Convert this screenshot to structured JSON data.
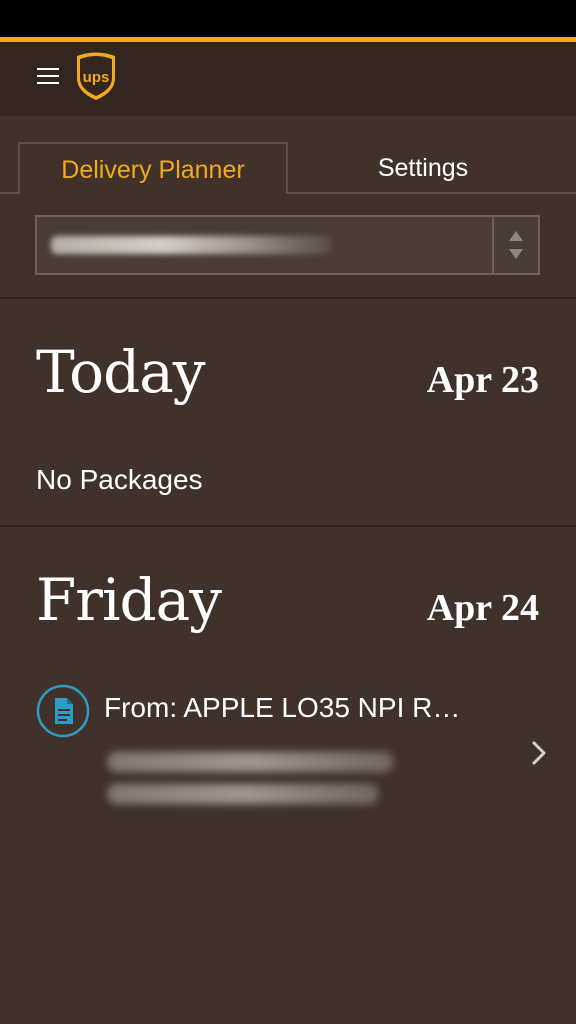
{
  "colors": {
    "background": "#40322b",
    "header": "#33261f",
    "accent": "#f2a91c",
    "icon_blue": "#2b9cc4",
    "text": "#ffffff"
  },
  "header": {
    "menu_icon": "hamburger-icon",
    "logo_text": "ups"
  },
  "tabs": [
    {
      "label": "Delivery Planner",
      "active": true
    },
    {
      "label": "Settings",
      "active": false
    }
  ],
  "picker": {
    "value": "",
    "icon": "up-down-arrows-icon"
  },
  "days": [
    {
      "title": "Today",
      "date": "Apr 23",
      "status": "No Packages"
    },
    {
      "title": "Friday",
      "date": "Apr 24",
      "packages": [
        {
          "from": "From: APPLE LO35 NPI R…",
          "icon": "document-icon"
        }
      ]
    }
  ]
}
